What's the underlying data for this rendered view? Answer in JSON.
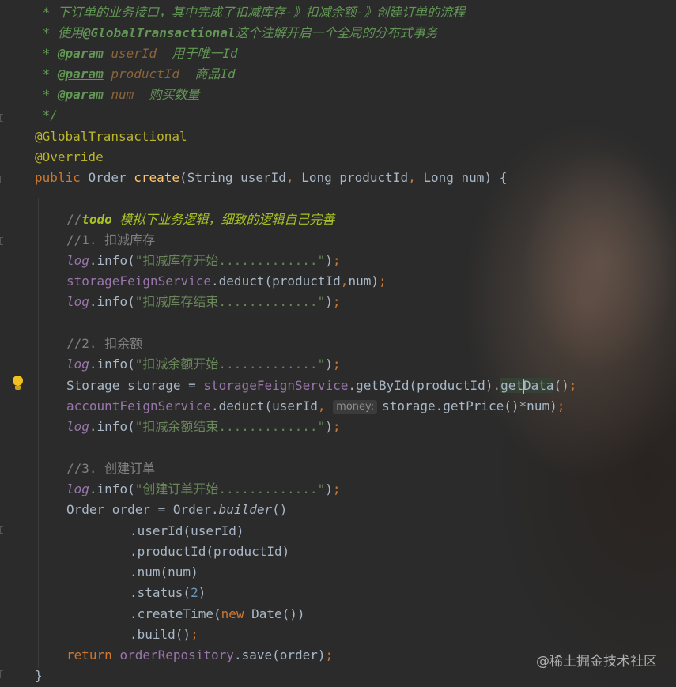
{
  "doc_comment": {
    "line1_prefix": " * ",
    "line1_text": "下订单的业务接口，其中完成了扣减库存-》扣减余额-》创建订单的流程",
    "line2_prefix": " * ",
    "line2_pre": "使用",
    "line2_bold": "@GlobalTransactional",
    "line2_post": "这个注解开启一个全局的分布式事务",
    "params": [
      {
        "tag": "@param",
        "name": "userId",
        "desc": "用于唯一Id"
      },
      {
        "tag": "@param",
        "name": "productId",
        "desc": "商品Id"
      },
      {
        "tag": "@param",
        "name": "num",
        "desc": "购买数量"
      }
    ],
    "close": " */"
  },
  "annotations": [
    "@GlobalTransactional",
    "@Override"
  ],
  "signature": {
    "modifier": "public",
    "return_type": "Order",
    "method": "create",
    "p1_type": "String",
    "p1_name": "userId",
    "p2_type": "Long",
    "p2_name": "productId",
    "p3_type": "Long",
    "p3_name": "num",
    "open": ") {"
  },
  "body": {
    "todo_prefix": "//",
    "todo_tag": "todo",
    "todo_text": " 模拟下业务逻辑，细致的逻辑自己完善",
    "c1": "//1. 扣减库存",
    "log1": "\"扣减库存开始.............\"",
    "storage_service": "storageFeignService",
    "deduct_call": ".deduct(productId",
    "deduct_args_end": "num)",
    "log2": "\"扣减库存结束.............\"",
    "c2": "//2. 扣余额",
    "log3": "\"扣减余额开始.............\"",
    "storage_decl": "Storage storage = ",
    "getbyid": ".getById(productId).",
    "get_before_caret": "get",
    "get_after_caret": "Data",
    "get_tail": "()",
    "account_service": "accountFeignService",
    "account_call": ".deduct(userId",
    "param_hint": "money:",
    "account_tail": "storage.getPrice()*num)",
    "log4": "\"扣减余额结束.............\"",
    "c3": "//3. 创建订单",
    "log5": "\"创建订单开始.............\"",
    "order_decl": "Order order = Order.",
    "builder": "builder",
    "builder_tail": "()",
    "chain_userid": ".userId(userId)",
    "chain_productid": ".productId(productId)",
    "chain_num": ".num(num)",
    "chain_status_pre": ".status(",
    "chain_status_val": "2",
    "chain_status_post": ")",
    "chain_ct_pre": ".createTime(",
    "chain_ct_new": "new",
    "chain_ct_post": " Date())",
    "chain_build": ".build()",
    "ret_kw": "return",
    "repo": "orderRepository",
    "save_call": ".save(order)",
    "close_brace": "}"
  },
  "log_var": "log",
  "info_call": ".info(",
  "info_close": ")",
  "semi": ";",
  "comma": ",",
  "watermark": "@稀土掘金技术社区",
  "icons": {
    "bulb": "lightbulb-icon"
  }
}
